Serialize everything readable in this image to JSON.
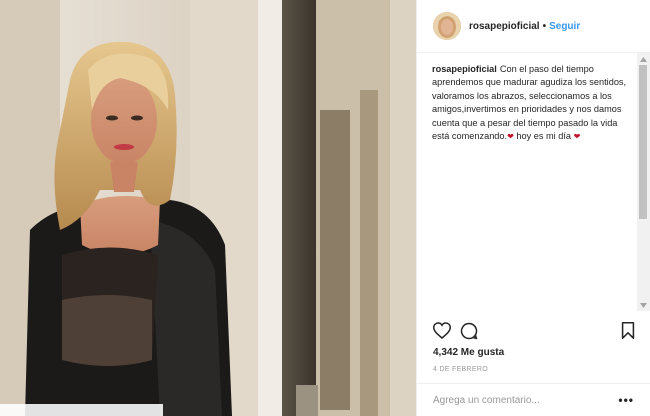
{
  "post": {
    "username": "rosapepioficial",
    "separator": "•",
    "follow_label": "Seguir",
    "caption_text": "Con el paso del tiempo aprendemos que madurar agudiza los sentidos, valoramos los abrazos, seleccionamos a los amigos,invertimos en prioridades y nos damos cuenta que a pesar del tiempo pasado la vida está comenzando.",
    "caption_tail": "hoy es mi día",
    "emoji_symbol": "❤",
    "likes": "4,342 Me gusta",
    "date": "4 DE FEBRERO",
    "comment_placeholder": "Agrega un comentario...",
    "more_label": "•••"
  },
  "photo": {
    "overlay_text": " "
  },
  "colors": {
    "link": "#3897f0",
    "text": "#262626",
    "muted": "#999999",
    "border": "#efefef"
  },
  "icons": [
    "heart-icon",
    "comment-icon",
    "bookmark-icon",
    "more-options-icon"
  ]
}
